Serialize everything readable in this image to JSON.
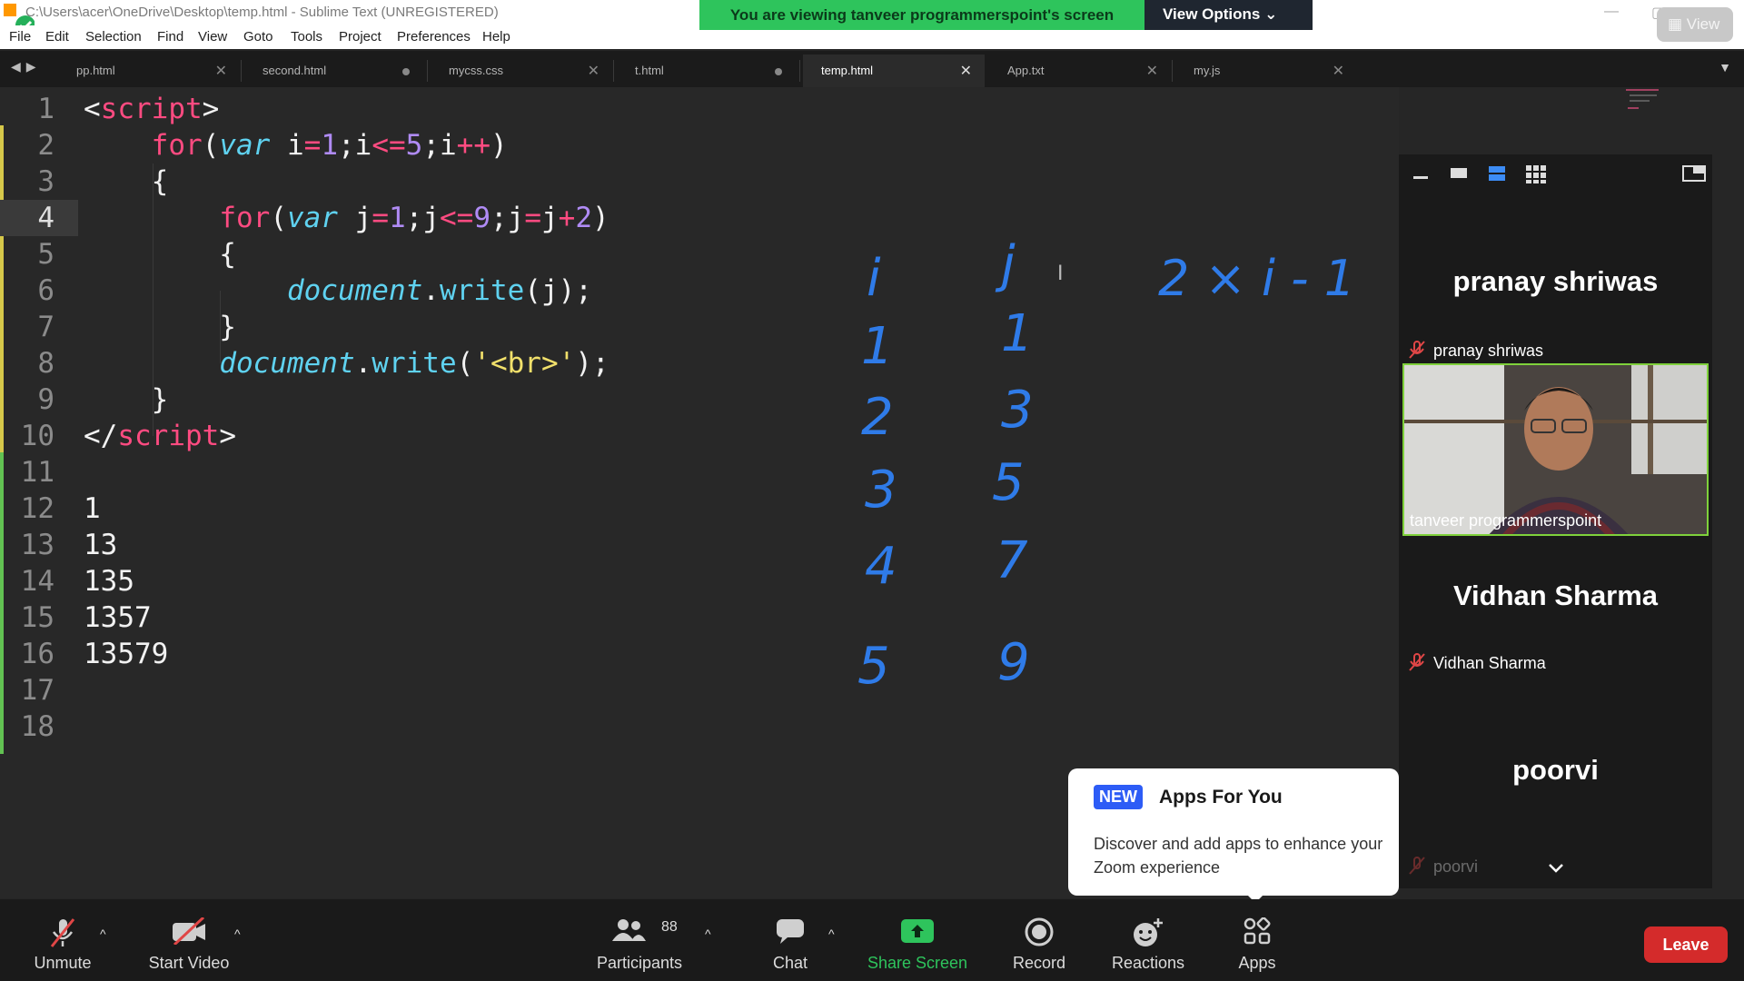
{
  "window": {
    "title": "C:\\Users\\acer\\OneDrive\\Desktop\\temp.html - Sublime Text (UNREGISTERED)"
  },
  "menu": [
    "File",
    "Edit",
    "Selection",
    "Find",
    "View",
    "Goto",
    "Tools",
    "Project",
    "Preferences",
    "Help"
  ],
  "zoom_banner": {
    "message": "You are viewing tanveer programmerspoint's screen",
    "view_options": "View Options",
    "view_button": "View"
  },
  "tabs": [
    {
      "label": "pp.html",
      "state": "close"
    },
    {
      "label": "second.html",
      "state": "modified"
    },
    {
      "label": "mycss.css",
      "state": "close"
    },
    {
      "label": "t.html",
      "state": "modified"
    },
    {
      "label": "temp.html",
      "state": "close",
      "active": true
    },
    {
      "label": "App.txt",
      "state": "close"
    },
    {
      "label": "my.js",
      "state": "close"
    }
  ],
  "editor": {
    "current_line": 4,
    "line_numbers": [
      "1",
      "2",
      "3",
      "4",
      "5",
      "6",
      "7",
      "8",
      "9",
      "10",
      "11",
      "12",
      "13",
      "14",
      "15",
      "16",
      "17",
      "18"
    ],
    "output_lines": [
      "1",
      "13",
      "135",
      "1357",
      "13579"
    ]
  },
  "handwriting": {
    "header_left": "i",
    "header_right": "j",
    "formula": "2 × i - 1",
    "col_i": [
      "1",
      "2",
      "3",
      "4",
      "5"
    ],
    "col_j": [
      "1",
      "3",
      "5",
      "7",
      "9"
    ]
  },
  "participants_panel": {
    "tiles": [
      {
        "display": "pranay shriwas",
        "label": "pranay shriwas",
        "muted": true
      },
      {
        "display": "video",
        "label": "tanveer programmerspoint",
        "muted": false
      },
      {
        "display": "Vidhan Sharma",
        "label": "Vidhan Sharma",
        "muted": true
      },
      {
        "display": "poorvi",
        "label": "poorvi",
        "muted": true
      }
    ]
  },
  "apps_popup": {
    "badge": "NEW",
    "title": "Apps For You",
    "body": "Discover and add apps to enhance your Zoom experience"
  },
  "zoom_toolbar": {
    "unmute": "Unmute",
    "start_video": "Start Video",
    "participants": "Participants",
    "participants_count": "88",
    "chat": "Chat",
    "share_screen": "Share Screen",
    "record": "Record",
    "reactions": "Reactions",
    "apps": "Apps",
    "leave": "Leave"
  },
  "colors": {
    "share_green": "#2ec45c",
    "leave_red": "#d42b2b",
    "ink_blue": "#2f7be8",
    "active_speaker": "#7fd13b"
  }
}
